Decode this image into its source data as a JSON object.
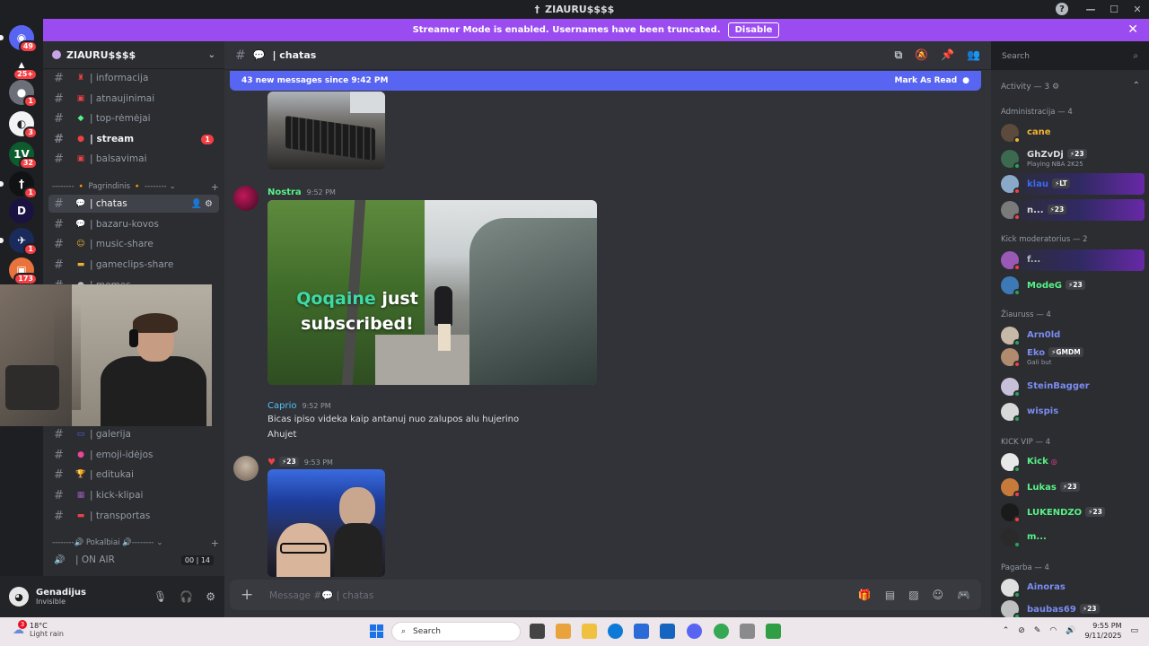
{
  "window": {
    "title": "ZIAURU$$$$"
  },
  "banner": {
    "text": "Streamer Mode is enabled. Usernames have been truncated.",
    "disable_label": "Disable"
  },
  "server_rail": {
    "items": [
      {
        "name": "home",
        "badge": "49",
        "color": "#5865f2",
        "glyph": "◉"
      },
      {
        "name": "server-2",
        "badge": "25+",
        "color": "#1e1f22",
        "glyph": "▲"
      },
      {
        "name": "server-3",
        "badge": "1",
        "color": "#6d6f78",
        "glyph": "●"
      },
      {
        "name": "server-4",
        "badge": "3",
        "color": "#f2f3f5",
        "glyph": "◐"
      },
      {
        "name": "server-5",
        "badge": "32",
        "color": "#0d5c2e",
        "glyph": "1V"
      },
      {
        "name": "server-6",
        "badge": "1",
        "color": "#111214",
        "glyph": "†"
      },
      {
        "name": "server-7",
        "badge": "",
        "color": "#1a1240",
        "glyph": "D"
      },
      {
        "name": "server-8",
        "badge": "1",
        "color": "#1a2a5a",
        "glyph": "✈"
      },
      {
        "name": "server-9",
        "badge": "173",
        "color": "#e8733c",
        "glyph": "▣"
      }
    ]
  },
  "sidebar": {
    "server_name": "ZIAURU$$$$",
    "channels_top": [
      {
        "label": "| informacija",
        "emoji": "♜",
        "emoji_color": "#ed4245"
      },
      {
        "label": "| atnaujinimai",
        "emoji": "▣",
        "emoji_color": "#ed4245"
      },
      {
        "label": "| top-rėmėjai",
        "emoji": "◆",
        "emoji_color": "#57f287"
      },
      {
        "label": "| stream",
        "emoji": "●",
        "emoji_color": "#ed4245",
        "badge": "1",
        "unread": true
      },
      {
        "label": "| balsavimai",
        "emoji": "▣",
        "emoji_color": "#ed4245"
      }
    ],
    "category1": "-------- 🔸 Pagrindinis 🔸 --------",
    "channels_main": [
      {
        "label": "| chatas",
        "emoji": "💬",
        "emoji_color": "#f2f3f5",
        "active": true
      },
      {
        "label": "| bazaru-kovos",
        "emoji": "💬",
        "emoji_color": "#f2f3f5"
      },
      {
        "label": "| music-share",
        "emoji": "☺",
        "emoji_color": "#f0b232"
      },
      {
        "label": "| gameclips-share",
        "emoji": "▬",
        "emoji_color": "#f0b232"
      },
      {
        "label": "| memes",
        "emoji": "●",
        "emoji_color": "#b5bac1"
      }
    ],
    "channels_lower": [
      {
        "label": "| galerija",
        "emoji": "▭",
        "emoji_color": "#5865f2"
      },
      {
        "label": "| emoji-idėjos",
        "emoji": "●",
        "emoji_color": "#eb459e"
      },
      {
        "label": "| editukai",
        "emoji": "🏆",
        "emoji_color": "#f0b232"
      },
      {
        "label": "| kick-klipai",
        "emoji": "▦",
        "emoji_color": "#9b59b6"
      },
      {
        "label": "| transportas",
        "emoji": "▬",
        "emoji_color": "#ed4245"
      }
    ],
    "category2": "--------🔊 Pokalbiai 🔊--------",
    "voice_channels": [
      {
        "label": "| ON AIR",
        "counts": "00 | 14"
      }
    ]
  },
  "user_panel": {
    "name": "Genadijus",
    "status": "Invisible"
  },
  "channel_header": {
    "name": "| chatas"
  },
  "new_messages": {
    "text": "43 new messages since 9:42 PM",
    "mark_label": "Mark As Read"
  },
  "messages": [
    {
      "author": "Nostra",
      "time": "9:52 PM",
      "color": "#57f287",
      "image_text_name": "Qoqaine",
      "image_text_rest": "just",
      "image_text_line2": "subscribed!"
    },
    {
      "author": "Caprio",
      "time": "9:52 PM",
      "color": "#4fc3f7",
      "lines": [
        "Bicas ipiso videka kaip antanuj nuo zalupos alu hujerino",
        "Ahujet"
      ]
    },
    {
      "author": "",
      "time": "9:53 PM",
      "boost": "23"
    }
  ],
  "composer": {
    "placeholder": "Message #💬 | chatas"
  },
  "search": {
    "placeholder": "Search"
  },
  "members": {
    "activity": "Activity — 3",
    "groups": [
      {
        "title": "Administracija — 4",
        "members": [
          {
            "name": "cane",
            "color": "#f0b232",
            "status": "#f0b232",
            "avatar": "#5c4a3c"
          },
          {
            "name": "GhZvDj",
            "color": "#dbdee1",
            "status": "#23a55a",
            "avatar": "#3b6a50",
            "boost": "23",
            "sub": "Playing NBA 2K25"
          },
          {
            "name": "klau",
            "color": "#3b6af0",
            "status": "#f23f43",
            "avatar": "#8aa8c8",
            "boost": "LT",
            "banner": true
          },
          {
            "name": "n...",
            "color": "#dbdee1",
            "status": "#f23f43",
            "avatar": "#7a7a7a",
            "boost": "23",
            "banner": true
          }
        ]
      },
      {
        "title": "Kick moderatorius — 2",
        "members": [
          {
            "name": "f...",
            "color": "#b5bac1",
            "status": "#f23f43",
            "avatar": "#9b59b6",
            "banner": true
          },
          {
            "name": "ModeG",
            "color": "#57f287",
            "status": "#23a55a",
            "avatar": "#3d7ab5",
            "boost": "23"
          }
        ]
      },
      {
        "title": "Žiauruss — 4",
        "members": [
          {
            "name": "Arn0ld",
            "color": "#7b8cf0",
            "status": "#23a55a",
            "avatar": "#c7b9a8"
          },
          {
            "name": "Eko",
            "color": "#7b8cf0",
            "status": "#f23f43",
            "avatar": "#b08b6e",
            "boost": "GMDM",
            "sub": "Gali but"
          },
          {
            "name": "SteinBagger",
            "color": "#7b8cf0",
            "status": "#23a55a",
            "avatar": "#c8c0d8"
          },
          {
            "name": "wispis",
            "color": "#7b8cf0",
            "status": "#23a55a",
            "avatar": "#d8d8d8"
          }
        ]
      },
      {
        "title": "KICK VIP — 4",
        "members": [
          {
            "name": "Kick",
            "color": "#57f287",
            "status": "#23a55a",
            "avatar": "#e8e8e8",
            "extra": "◎"
          },
          {
            "name": "Lukas",
            "color": "#57f287",
            "status": "#f23f43",
            "avatar": "#c87a3a",
            "boost": "23"
          },
          {
            "name": "LUKENDZO",
            "color": "#57f287",
            "status": "#f23f43",
            "avatar": "#1a1a1a",
            "boost": "23"
          },
          {
            "name": "m...",
            "color": "#57f287",
            "status": "#23a55a",
            "avatar": "#2a2a2a"
          }
        ]
      },
      {
        "title": "Pagarba — 4",
        "members": [
          {
            "name": "Ainoras",
            "color": "#7b8cf0",
            "status": "#23a55a",
            "avatar": "#e0e0e0"
          },
          {
            "name": "baubas69",
            "color": "#7b8cf0",
            "status": "#23a55a",
            "avatar": "#c0c0c0",
            "boost": "23"
          }
        ]
      }
    ]
  },
  "taskbar": {
    "weather_badge": "3",
    "temp": "18°C",
    "weather": "Light rain",
    "search": "Search",
    "time": "9:55 PM",
    "date": "9/11/2025",
    "apps": [
      "#444",
      "#e8a33c",
      "#f0c040",
      "#0e7ad8",
      "#2a6bd8",
      "#1565c0",
      "#5865f2",
      "#34a853",
      "#8a8a8a",
      "#2f9e44"
    ]
  }
}
